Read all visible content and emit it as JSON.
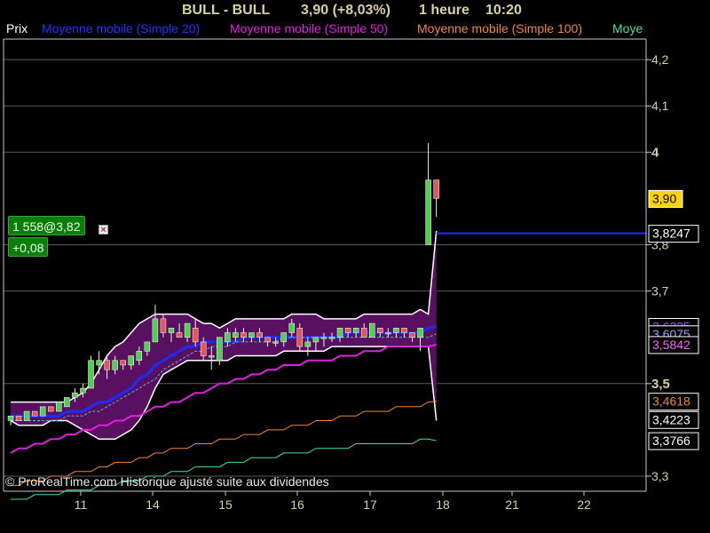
{
  "header": {
    "symbol": "BULL - BULL",
    "quote": "3,90 (+8,03%)",
    "period": "1 heure",
    "time": "10:20"
  },
  "legend": [
    {
      "label": "Prix",
      "color": "#ffffff"
    },
    {
      "label": "Moyenne mobile (Simple 20)",
      "color": "#2233ff"
    },
    {
      "label": "Moyenne mobile (Simple 50)",
      "color": "#e020e0"
    },
    {
      "label": "Moyenne mobile (Simple 100)",
      "color": "#f08830"
    },
    {
      "label": "Moye",
      "color": "#40e0b0"
    }
  ],
  "position": {
    "label": "1 558@3,82",
    "pnl": "+0,08",
    "close_icon": "close-x-icon"
  },
  "copyright": "© ProRealTime.com Historique ajusté suite aux dividendes",
  "chart_data": {
    "type": "candlestick",
    "ylim": [
      3.28,
      4.29
    ],
    "y_ticks": [
      {
        "value": 4.2,
        "label": "4,2"
      },
      {
        "value": 4.1,
        "label": "4,1"
      },
      {
        "value": 4.0,
        "label": "4",
        "bold": true
      },
      {
        "value": 3.8,
        "label": "3,8"
      },
      {
        "value": 3.7,
        "label": "3,7"
      },
      {
        "value": 3.5,
        "label": "3,5",
        "bold": true
      },
      {
        "value": 3.3,
        "label": "3,3"
      }
    ],
    "x_ticks": [
      "11",
      "14",
      "15",
      "16",
      "17",
      "18",
      "21",
      "22"
    ],
    "last_price": {
      "value": 3.9,
      "label": "3,90",
      "color": "#ffd400"
    },
    "indicator_labels": [
      {
        "value": 3.8247,
        "label": "3,8247",
        "color": "#ffffff",
        "border": "#ffffff"
      },
      {
        "value": 3.6235,
        "label": "3,6235",
        "color": "#b040ff",
        "border": "#ffffff"
      },
      {
        "value": 3.6075,
        "label": "3,6075",
        "color": "#a0a0ff",
        "border": "#ffffff"
      },
      {
        "value": 3.5842,
        "label": "3,5842",
        "color": "#ff60ff",
        "border": "#ffffff"
      },
      {
        "value": 3.4618,
        "label": "3,4618",
        "color": "#f08830",
        "border": "#ffffff"
      },
      {
        "value": 3.4223,
        "label": "3,4223",
        "color": "#ffffff",
        "border": "#ffffff"
      },
      {
        "value": 3.3766,
        "label": "3,3766",
        "color": "#ffffff",
        "border": "#ffffff"
      }
    ],
    "position_line": 3.8247,
    "bollinger": {
      "upper": [
        3.46,
        3.46,
        3.46,
        3.46,
        3.46,
        3.46,
        3.46,
        3.46,
        3.47,
        3.48,
        3.5,
        3.53,
        3.56,
        3.58,
        3.59,
        3.61,
        3.63,
        3.64,
        3.65,
        3.65,
        3.65,
        3.65,
        3.65,
        3.64,
        3.63,
        3.63,
        3.62,
        3.63,
        3.64,
        3.64,
        3.64,
        3.64,
        3.64,
        3.64,
        3.64,
        3.65,
        3.65,
        3.65,
        3.65,
        3.64,
        3.64,
        3.64,
        3.64,
        3.64,
        3.65,
        3.65,
        3.65,
        3.65,
        3.65,
        3.65,
        3.65,
        3.66,
        3.65,
        3.83
      ],
      "lower": [
        3.42,
        3.41,
        3.41,
        3.41,
        3.41,
        3.42,
        3.42,
        3.42,
        3.41,
        3.4,
        3.39,
        3.38,
        3.38,
        3.38,
        3.39,
        3.4,
        3.42,
        3.45,
        3.49,
        3.52,
        3.53,
        3.54,
        3.55,
        3.55,
        3.55,
        3.55,
        3.55,
        3.55,
        3.56,
        3.56,
        3.56,
        3.56,
        3.56,
        3.56,
        3.57,
        3.57,
        3.57,
        3.57,
        3.57,
        3.57,
        3.58,
        3.58,
        3.58,
        3.58,
        3.58,
        3.58,
        3.58,
        3.58,
        3.58,
        3.58,
        3.58,
        3.58,
        3.58,
        3.42
      ]
    },
    "moving_averages": [
      {
        "period": 20,
        "color": "#1c2cff",
        "width": 3,
        "values": [
          3.43,
          3.43,
          3.43,
          3.43,
          3.43,
          3.43,
          3.43,
          3.44,
          3.44,
          3.44,
          3.45,
          3.46,
          3.46,
          3.47,
          3.48,
          3.49,
          3.51,
          3.52,
          3.54,
          3.55,
          3.56,
          3.57,
          3.58,
          3.58,
          3.59,
          3.59,
          3.59,
          3.59,
          3.59,
          3.6,
          3.6,
          3.6,
          3.6,
          3.6,
          3.6,
          3.6,
          3.6,
          3.6,
          3.6,
          3.6,
          3.6,
          3.6,
          3.61,
          3.61,
          3.61,
          3.61,
          3.61,
          3.61,
          3.61,
          3.61,
          3.61,
          3.61,
          3.62,
          3.6235
        ]
      },
      {
        "period": 50,
        "color": "#e020e0",
        "width": 2,
        "values": [
          3.35,
          3.36,
          3.36,
          3.37,
          3.37,
          3.38,
          3.38,
          3.39,
          3.39,
          3.4,
          3.4,
          3.41,
          3.41,
          3.42,
          3.42,
          3.43,
          3.43,
          3.44,
          3.45,
          3.45,
          3.46,
          3.46,
          3.47,
          3.48,
          3.48,
          3.49,
          3.5,
          3.5,
          3.51,
          3.51,
          3.52,
          3.52,
          3.53,
          3.53,
          3.54,
          3.54,
          3.54,
          3.55,
          3.55,
          3.55,
          3.55,
          3.56,
          3.56,
          3.56,
          3.57,
          3.57,
          3.57,
          3.58,
          3.58,
          3.58,
          3.58,
          3.58,
          3.58,
          3.5842
        ]
      },
      {
        "period": 100,
        "color": "#f08830",
        "width": 1,
        "values": [
          3.28,
          3.28,
          3.29,
          3.29,
          3.29,
          3.3,
          3.3,
          3.3,
          3.31,
          3.31,
          3.31,
          3.32,
          3.32,
          3.33,
          3.33,
          3.33,
          3.34,
          3.34,
          3.35,
          3.35,
          3.36,
          3.36,
          3.36,
          3.37,
          3.37,
          3.37,
          3.38,
          3.38,
          3.38,
          3.39,
          3.39,
          3.39,
          3.4,
          3.4,
          3.4,
          3.41,
          3.41,
          3.41,
          3.42,
          3.42,
          3.42,
          3.43,
          3.43,
          3.43,
          3.44,
          3.44,
          3.44,
          3.44,
          3.45,
          3.45,
          3.45,
          3.45,
          3.46,
          3.4618
        ]
      },
      {
        "period": 200,
        "color": "#40e0b0",
        "width": 1,
        "values": [
          3.25,
          3.25,
          3.25,
          3.26,
          3.26,
          3.26,
          3.26,
          3.27,
          3.27,
          3.27,
          3.27,
          3.28,
          3.28,
          3.28,
          3.29,
          3.29,
          3.29,
          3.3,
          3.3,
          3.3,
          3.31,
          3.31,
          3.31,
          3.32,
          3.32,
          3.32,
          3.32,
          3.33,
          3.33,
          3.33,
          3.34,
          3.34,
          3.34,
          3.34,
          3.35,
          3.35,
          3.35,
          3.35,
          3.36,
          3.36,
          3.36,
          3.36,
          3.36,
          3.37,
          3.37,
          3.37,
          3.37,
          3.37,
          3.37,
          3.37,
          3.37,
          3.38,
          3.38,
          3.3766
        ]
      }
    ],
    "ma20_dashed": {
      "color": "#40c0d0",
      "values": [
        3.42,
        3.42,
        3.42,
        3.42,
        3.42,
        3.42,
        3.42,
        3.43,
        3.43,
        3.43,
        3.44,
        3.44,
        3.45,
        3.46,
        3.47,
        3.48,
        3.49,
        3.5,
        3.51,
        3.53,
        3.54,
        3.55,
        3.56,
        3.57,
        3.57,
        3.58,
        3.58,
        3.58,
        3.59,
        3.59,
        3.59,
        3.59,
        3.59,
        3.59,
        3.6,
        3.6,
        3.6,
        3.6,
        3.6,
        3.6,
        3.6,
        3.6,
        3.6,
        3.6,
        3.6,
        3.6,
        3.6,
        3.6,
        3.6,
        3.6,
        3.6,
        3.6,
        3.6,
        3.6075
      ]
    },
    "candles": [
      {
        "o": 3.42,
        "h": 3.43,
        "l": 3.41,
        "c": 3.43
      },
      {
        "o": 3.43,
        "h": 3.43,
        "l": 3.42,
        "c": 3.42
      },
      {
        "o": 3.42,
        "h": 3.44,
        "l": 3.42,
        "c": 3.44
      },
      {
        "o": 3.44,
        "h": 3.44,
        "l": 3.43,
        "c": 3.43
      },
      {
        "o": 3.43,
        "h": 3.45,
        "l": 3.43,
        "c": 3.45
      },
      {
        "o": 3.45,
        "h": 3.45,
        "l": 3.44,
        "c": 3.44
      },
      {
        "o": 3.44,
        "h": 3.46,
        "l": 3.44,
        "c": 3.46
      },
      {
        "o": 3.45,
        "h": 3.47,
        "l": 3.45,
        "c": 3.47
      },
      {
        "o": 3.47,
        "h": 3.49,
        "l": 3.46,
        "c": 3.48
      },
      {
        "o": 3.48,
        "h": 3.5,
        "l": 3.47,
        "c": 3.49
      },
      {
        "o": 3.49,
        "h": 3.56,
        "l": 3.49,
        "c": 3.55
      },
      {
        "o": 3.54,
        "h": 3.57,
        "l": 3.52,
        "c": 3.55
      },
      {
        "o": 3.55,
        "h": 3.56,
        "l": 3.51,
        "c": 3.53
      },
      {
        "o": 3.53,
        "h": 3.56,
        "l": 3.52,
        "c": 3.55
      },
      {
        "o": 3.55,
        "h": 3.55,
        "l": 3.53,
        "c": 3.54
      },
      {
        "o": 3.54,
        "h": 3.56,
        "l": 3.53,
        "c": 3.56
      },
      {
        "o": 3.55,
        "h": 3.58,
        "l": 3.54,
        "c": 3.57
      },
      {
        "o": 3.57,
        "h": 3.59,
        "l": 3.56,
        "c": 3.59
      },
      {
        "o": 3.59,
        "h": 3.67,
        "l": 3.59,
        "c": 3.64
      },
      {
        "o": 3.64,
        "h": 3.65,
        "l": 3.6,
        "c": 3.61
      },
      {
        "o": 3.61,
        "h": 3.62,
        "l": 3.59,
        "c": 3.62
      },
      {
        "o": 3.61,
        "h": 3.63,
        "l": 3.6,
        "c": 3.6
      },
      {
        "o": 3.6,
        "h": 3.63,
        "l": 3.59,
        "c": 3.63
      },
      {
        "o": 3.62,
        "h": 3.64,
        "l": 3.58,
        "c": 3.59
      },
      {
        "o": 3.59,
        "h": 3.6,
        "l": 3.55,
        "c": 3.56
      },
      {
        "o": 3.56,
        "h": 3.58,
        "l": 3.53,
        "c": 3.56
      },
      {
        "o": 3.55,
        "h": 3.6,
        "l": 3.54,
        "c": 3.6
      },
      {
        "o": 3.59,
        "h": 3.62,
        "l": 3.58,
        "c": 3.61
      },
      {
        "o": 3.6,
        "h": 3.62,
        "l": 3.59,
        "c": 3.61
      },
      {
        "o": 3.61,
        "h": 3.62,
        "l": 3.59,
        "c": 3.6
      },
      {
        "o": 3.6,
        "h": 3.61,
        "l": 3.59,
        "c": 3.61
      },
      {
        "o": 3.61,
        "h": 3.62,
        "l": 3.59,
        "c": 3.6
      },
      {
        "o": 3.6,
        "h": 3.6,
        "l": 3.58,
        "c": 3.59
      },
      {
        "o": 3.59,
        "h": 3.6,
        "l": 3.58,
        "c": 3.59
      },
      {
        "o": 3.59,
        "h": 3.61,
        "l": 3.58,
        "c": 3.61
      },
      {
        "o": 3.61,
        "h": 3.64,
        "l": 3.6,
        "c": 3.63
      },
      {
        "o": 3.62,
        "h": 3.63,
        "l": 3.57,
        "c": 3.58
      },
      {
        "o": 3.58,
        "h": 3.6,
        "l": 3.56,
        "c": 3.59
      },
      {
        "o": 3.59,
        "h": 3.6,
        "l": 3.57,
        "c": 3.6
      },
      {
        "o": 3.6,
        "h": 3.61,
        "l": 3.58,
        "c": 3.6
      },
      {
        "o": 3.6,
        "h": 3.61,
        "l": 3.59,
        "c": 3.6
      },
      {
        "o": 3.6,
        "h": 3.62,
        "l": 3.59,
        "c": 3.62
      },
      {
        "o": 3.62,
        "h": 3.62,
        "l": 3.6,
        "c": 3.61
      },
      {
        "o": 3.61,
        "h": 3.62,
        "l": 3.6,
        "c": 3.62
      },
      {
        "o": 3.62,
        "h": 3.63,
        "l": 3.6,
        "c": 3.6
      },
      {
        "o": 3.6,
        "h": 3.63,
        "l": 3.6,
        "c": 3.63
      },
      {
        "o": 3.62,
        "h": 3.62,
        "l": 3.6,
        "c": 3.61
      },
      {
        "o": 3.61,
        "h": 3.62,
        "l": 3.6,
        "c": 3.61
      },
      {
        "o": 3.61,
        "h": 3.62,
        "l": 3.6,
        "c": 3.62
      },
      {
        "o": 3.62,
        "h": 3.62,
        "l": 3.6,
        "c": 3.61
      },
      {
        "o": 3.61,
        "h": 3.61,
        "l": 3.59,
        "c": 3.6
      },
      {
        "o": 3.6,
        "h": 3.62,
        "l": 3.57,
        "c": 3.62
      },
      {
        "o": 3.8,
        "h": 4.02,
        "l": 3.8,
        "c": 3.94
      },
      {
        "o": 3.94,
        "h": 3.94,
        "l": 3.86,
        "c": 3.9
      }
    ]
  }
}
